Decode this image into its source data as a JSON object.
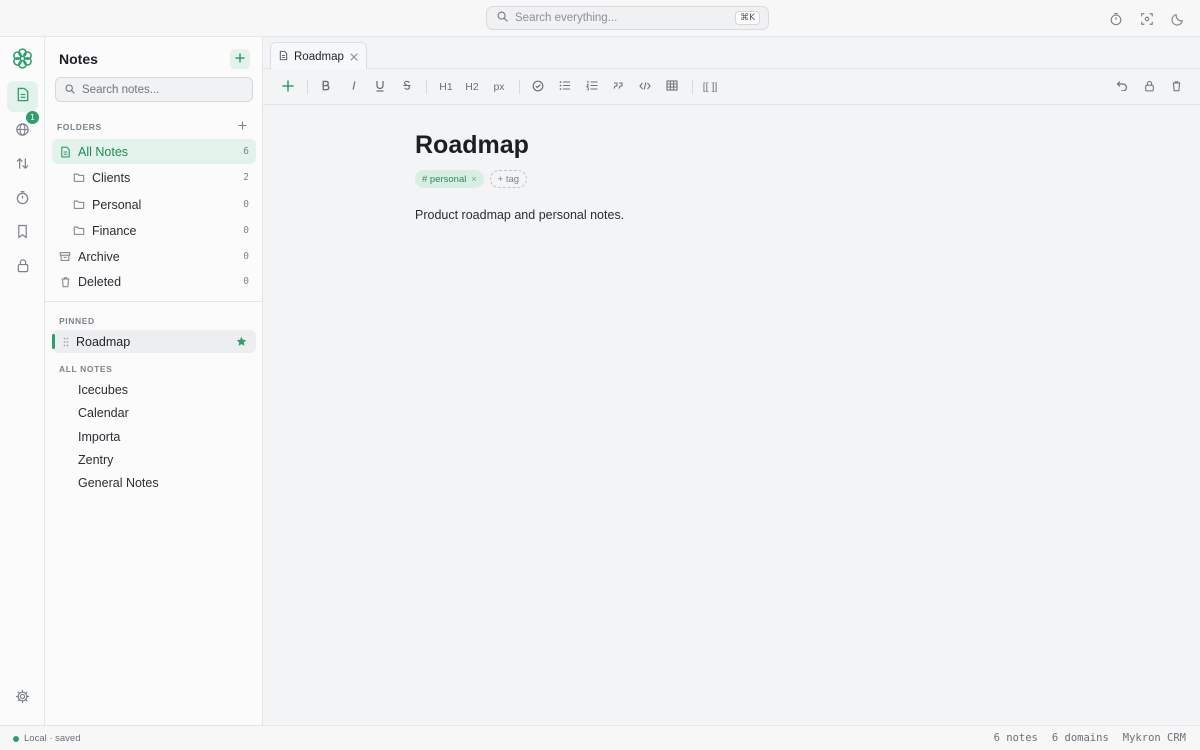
{
  "app": {
    "title": "Notes",
    "brand_color": "#2e9e6a",
    "accent_bg": "#e3f2ea"
  },
  "topbar": {
    "search_placeholder": "Search everything...",
    "search_shortcut": "⌘K",
    "icons": [
      "timer-icon",
      "focus-icon",
      "moon-icon"
    ]
  },
  "rail": {
    "items": [
      {
        "icon": "notes-icon",
        "active": true
      },
      {
        "icon": "globe-icon",
        "badge": "1"
      },
      {
        "icon": "sort-icon"
      },
      {
        "icon": "timer-icon"
      },
      {
        "icon": "bookmark-icon"
      },
      {
        "icon": "lock-icon"
      }
    ],
    "settings_icon": "gear-icon"
  },
  "sidebar": {
    "title": "Notes",
    "search_placeholder": "Search notes...",
    "folders_label": "FOLDERS",
    "folders": [
      {
        "label": "All Notes",
        "count": "6",
        "active": true
      },
      {
        "label": "Clients",
        "count": "2"
      },
      {
        "label": "Personal",
        "count": "0"
      },
      {
        "label": "Finance",
        "count": "0"
      },
      {
        "label": "Archive",
        "count": "0"
      },
      {
        "label": "Deleted",
        "count": "0"
      }
    ],
    "pinned_label": "PINNED",
    "pinned": [
      {
        "label": "Roadmap"
      }
    ],
    "all_notes_label": "ALL NOTES",
    "notes": [
      "Icecubes",
      "Calendar",
      "Importa",
      "Zentry",
      "General Notes"
    ]
  },
  "editor": {
    "tab": {
      "label": "Roadmap"
    },
    "toolbar": {
      "h1": "H1",
      "h2": "H2",
      "px": "px",
      "wikilink": "[[ ]]"
    },
    "doc": {
      "title": "Roadmap",
      "tags": [
        {
          "label": "# personal"
        }
      ],
      "add_tag": "+ tag",
      "body": "Product roadmap and personal notes."
    }
  },
  "status": {
    "left": "Local · saved",
    "notes_count": "6 notes",
    "domains_count": "6 domains",
    "app_name": "Mykron CRM"
  }
}
